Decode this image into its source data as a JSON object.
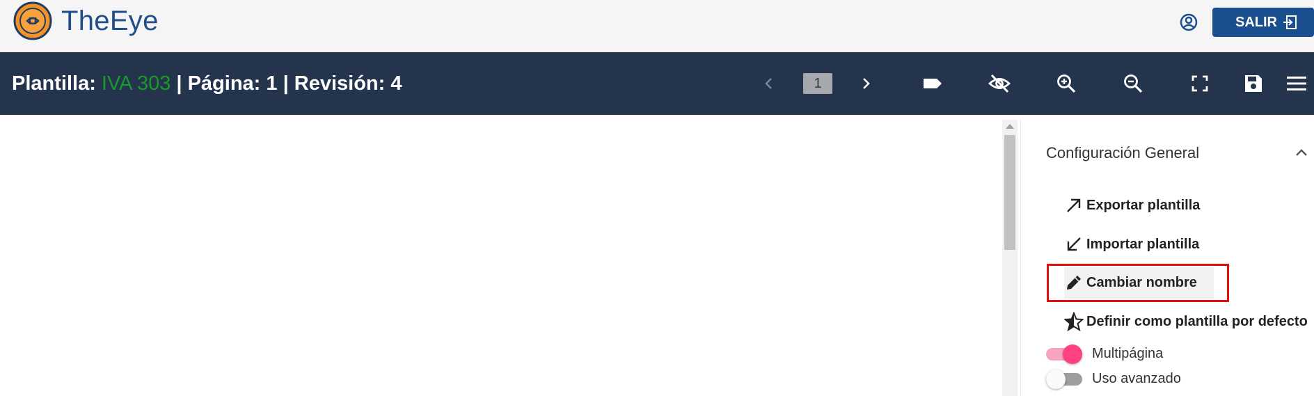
{
  "header": {
    "brand": "TheEye",
    "exit_label": "SALIR",
    "icons": {
      "logo": "eye-logo-icon",
      "user": "user-circle-icon",
      "exit": "exit-icon"
    },
    "colors": {
      "brand": "#1f4e8c",
      "logo_orange": "#f39325",
      "button": "#1a4f8f"
    }
  },
  "toolbar": {
    "template_label": "Plantilla: ",
    "template_name": "IVA 303",
    "page_label": " | Página: ",
    "page_value": "1",
    "revision_label": " | Revisión: ",
    "revision_value": "4",
    "current_page": "1",
    "icons": [
      "chevron-left-icon",
      "chevron-right-icon",
      "label-icon",
      "visibility-off-icon",
      "zoom-in-icon",
      "zoom-out-icon",
      "fullscreen-icon",
      "save-icon",
      "menu-icon"
    ],
    "colors": {
      "background": "#24344d",
      "template_name": "#179a2b"
    }
  },
  "panel": {
    "title": "Configuración General",
    "items": [
      {
        "label": "Exportar plantilla",
        "icon": "arrow-up-right-icon"
      },
      {
        "label": "Importar plantilla",
        "icon": "arrow-down-left-icon"
      },
      {
        "label": "Cambiar nombre",
        "icon": "pencil-icon"
      },
      {
        "label": "Definir como plantilla por defecto",
        "icon": "star-icon"
      }
    ],
    "toggles": [
      {
        "label": "Multipágina",
        "on": true
      },
      {
        "label": "Uso avanzado",
        "on": false
      }
    ],
    "colors": {
      "toggle_on": "#ff4081",
      "toggle_track_on": "#f9a3c3",
      "highlight": "#e01010"
    }
  }
}
